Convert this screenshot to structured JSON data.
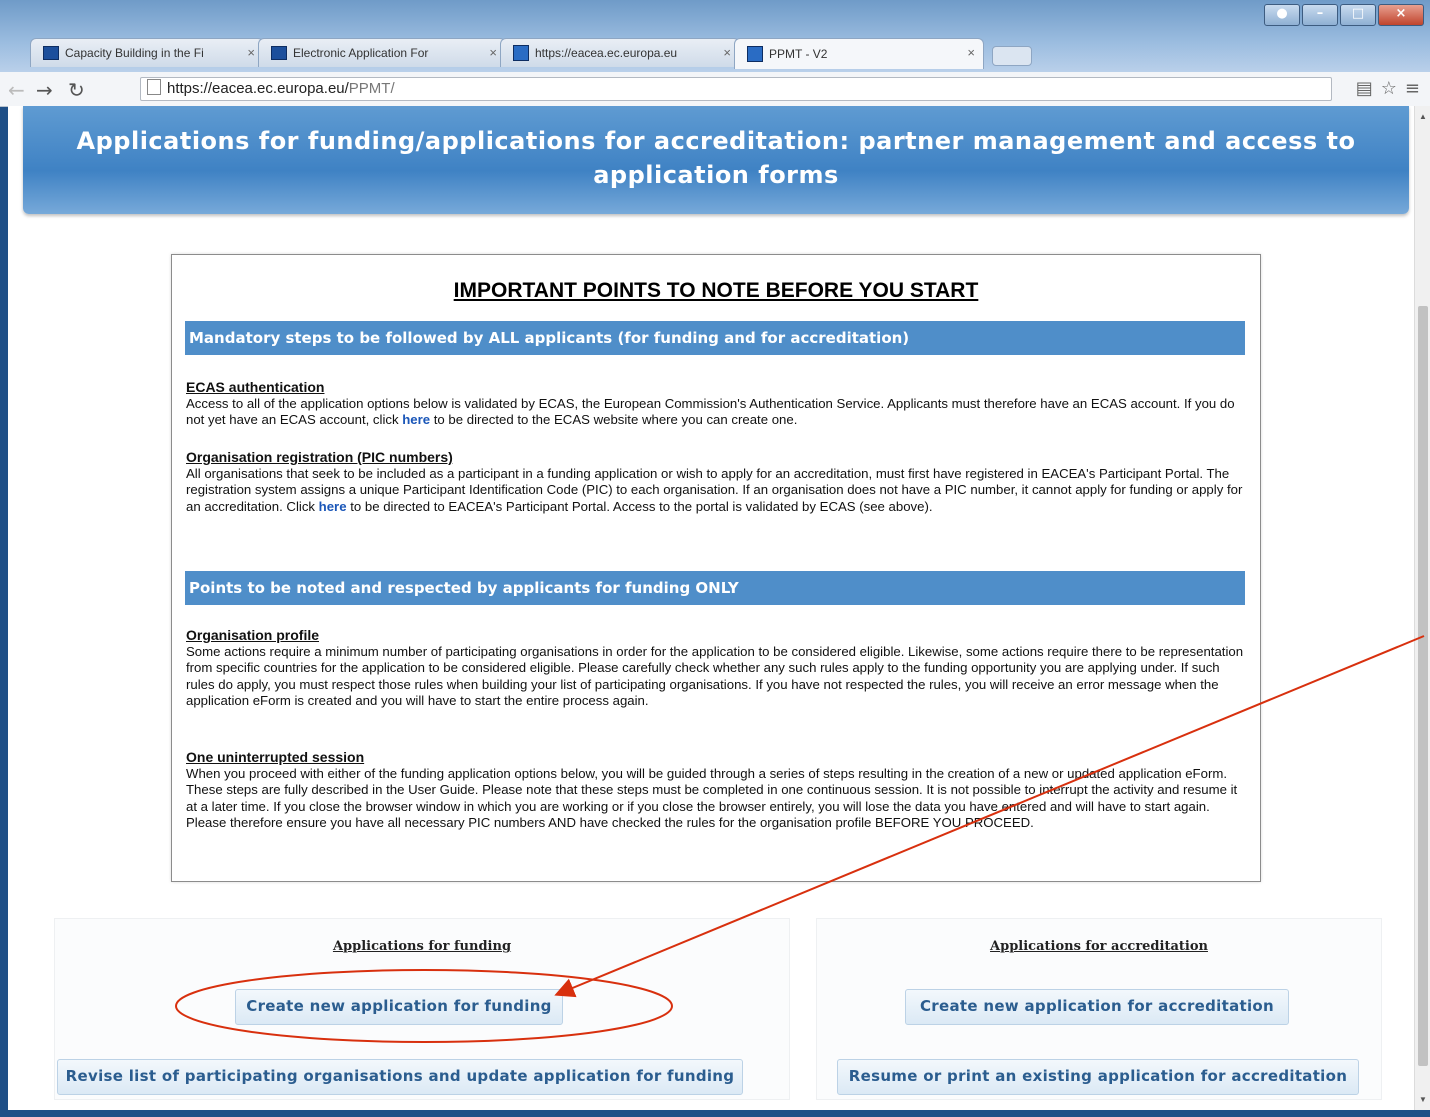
{
  "browser": {
    "tabs": [
      {
        "label": "Capacity Building in the Fi"
      },
      {
        "label": "Electronic Application For"
      },
      {
        "label": "https://eacea.ec.europa.eu"
      },
      {
        "label": "PPMT - V2"
      }
    ],
    "url_host": "https://eacea.ec.europa.eu/",
    "url_path": "PPMT/"
  },
  "header": {
    "title": "Applications for funding/applications for accreditation: partner management and access to application forms"
  },
  "notes": {
    "heading": "IMPORTANT POINTS TO NOTE BEFORE YOU START",
    "section1": "Mandatory steps to be followed by ALL applicants (for funding and for accreditation)",
    "ecas_title": "ECAS authentication",
    "ecas_text_a": "Access to all of the application options below is validated by ECAS, the European Commission's Authentication Service. Applicants must therefore have an ECAS account. If you do not yet have an ECAS account, click ",
    "ecas_link": "here",
    "ecas_text_b": " to be directed to the ECAS website where you can create one.",
    "pic_title": "Organisation registration (PIC numbers)",
    "pic_text_a": "All organisations that seek to be included as a participant in a funding application or wish to apply for an accreditation, must first have registered in EACEA's Participant Portal. The registration system assigns a unique Participant Identification Code (PIC) to each organisation. If an organisation does not have a PIC number, it cannot apply for funding or apply for an accreditation. Click ",
    "pic_link": "here",
    "pic_text_b": " to be directed to EACEA's Participant Portal. Access to the portal is validated by ECAS (see above).",
    "section2": "Points to be noted and respected by applicants for funding ONLY",
    "profile_title": "Organisation profile",
    "profile_text": "Some actions require a minimum number of participating organisations in order for the application to be considered eligible. Likewise, some actions require there to be representation from specific countries for the application to be considered eligible. Please carefully check whether any such rules apply to the funding opportunity you are applying under. If such rules do apply, you must respect those rules when building your list of participating organisations. If you have not respected the rules, you will receive an error message when the application eForm is created and you will have to start the entire process again.",
    "session_title": "One uninterrupted session",
    "session_text": "When you proceed with either of the funding application options below, you will be guided through a series of steps resulting in the creation of a new or updated application eForm. These steps are fully described in the User Guide. Please note that these steps must be completed in one continuous session. It is not possible to interrupt the activity and resume it at a later time. If you close the browser window in which you are working or if you close the browser entirely, you will lose the data you have entered and will have to start again. Please therefore ensure you have all necessary PIC numbers AND have checked the rules for the organisation profile BEFORE YOU PROCEED."
  },
  "funding": {
    "title": "Applications for funding",
    "create_label": "Create new application for funding",
    "revise_label": "Revise list of participating organisations and update application for funding"
  },
  "accreditation": {
    "title": "Applications for accreditation",
    "create_label": "Create new application for accreditation",
    "resume_label": "Resume or print an existing application for accreditation"
  },
  "annotation_color": "#d8300e"
}
